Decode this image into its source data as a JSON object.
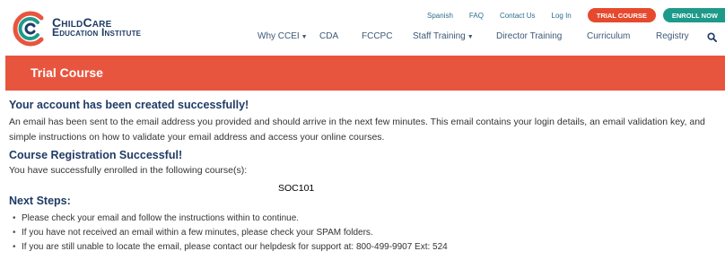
{
  "brand": {
    "line1": "ChildCare",
    "line2": "Education Institute"
  },
  "top_links": [
    "Spanish",
    "FAQ",
    "Contact Us",
    "Log In"
  ],
  "buttons": {
    "trial": "TRIAL COURSE",
    "enroll": "ENROLL NOW"
  },
  "nav": [
    {
      "label": "Why CCEI",
      "dropdown": true
    },
    {
      "label": "CDA",
      "dropdown": false
    },
    {
      "label": "FCCPC",
      "dropdown": false
    },
    {
      "label": "Staff Training",
      "dropdown": true
    },
    {
      "label": "Director Training",
      "dropdown": false
    },
    {
      "label": "Curriculum",
      "dropdown": false
    },
    {
      "label": "Registry",
      "dropdown": false
    }
  ],
  "banner": {
    "title": "Trial Course"
  },
  "account": {
    "heading": "Your account has been created successfully!",
    "body": "An email has been sent to the email address you provided and should arrive in the next few minutes. This email contains your login details, an email validation key, and simple instructions on how to validate your email address and access your online courses."
  },
  "registration": {
    "heading": "Course Registration Successful!",
    "body": "You have successfully enrolled in the following course(s):",
    "course": "SOC101"
  },
  "next_steps": {
    "heading": "Next Steps:",
    "items": [
      "Please check your email and follow the instructions within to continue.",
      "If you have not received an email within a few minutes, please check your SPAM folders.",
      "If you are still unable to locate the email, please contact our helpdesk for support at: 800-499-9907 Ext: 524"
    ]
  },
  "colors": {
    "brand_navy": "#1f3b66",
    "banner": "#e8553e",
    "trial_button": "#e64a2e",
    "enroll_button": "#1e9a8a"
  },
  "icons": [
    "logo-mark-icon",
    "chevron-down-icon",
    "search-icon"
  ]
}
